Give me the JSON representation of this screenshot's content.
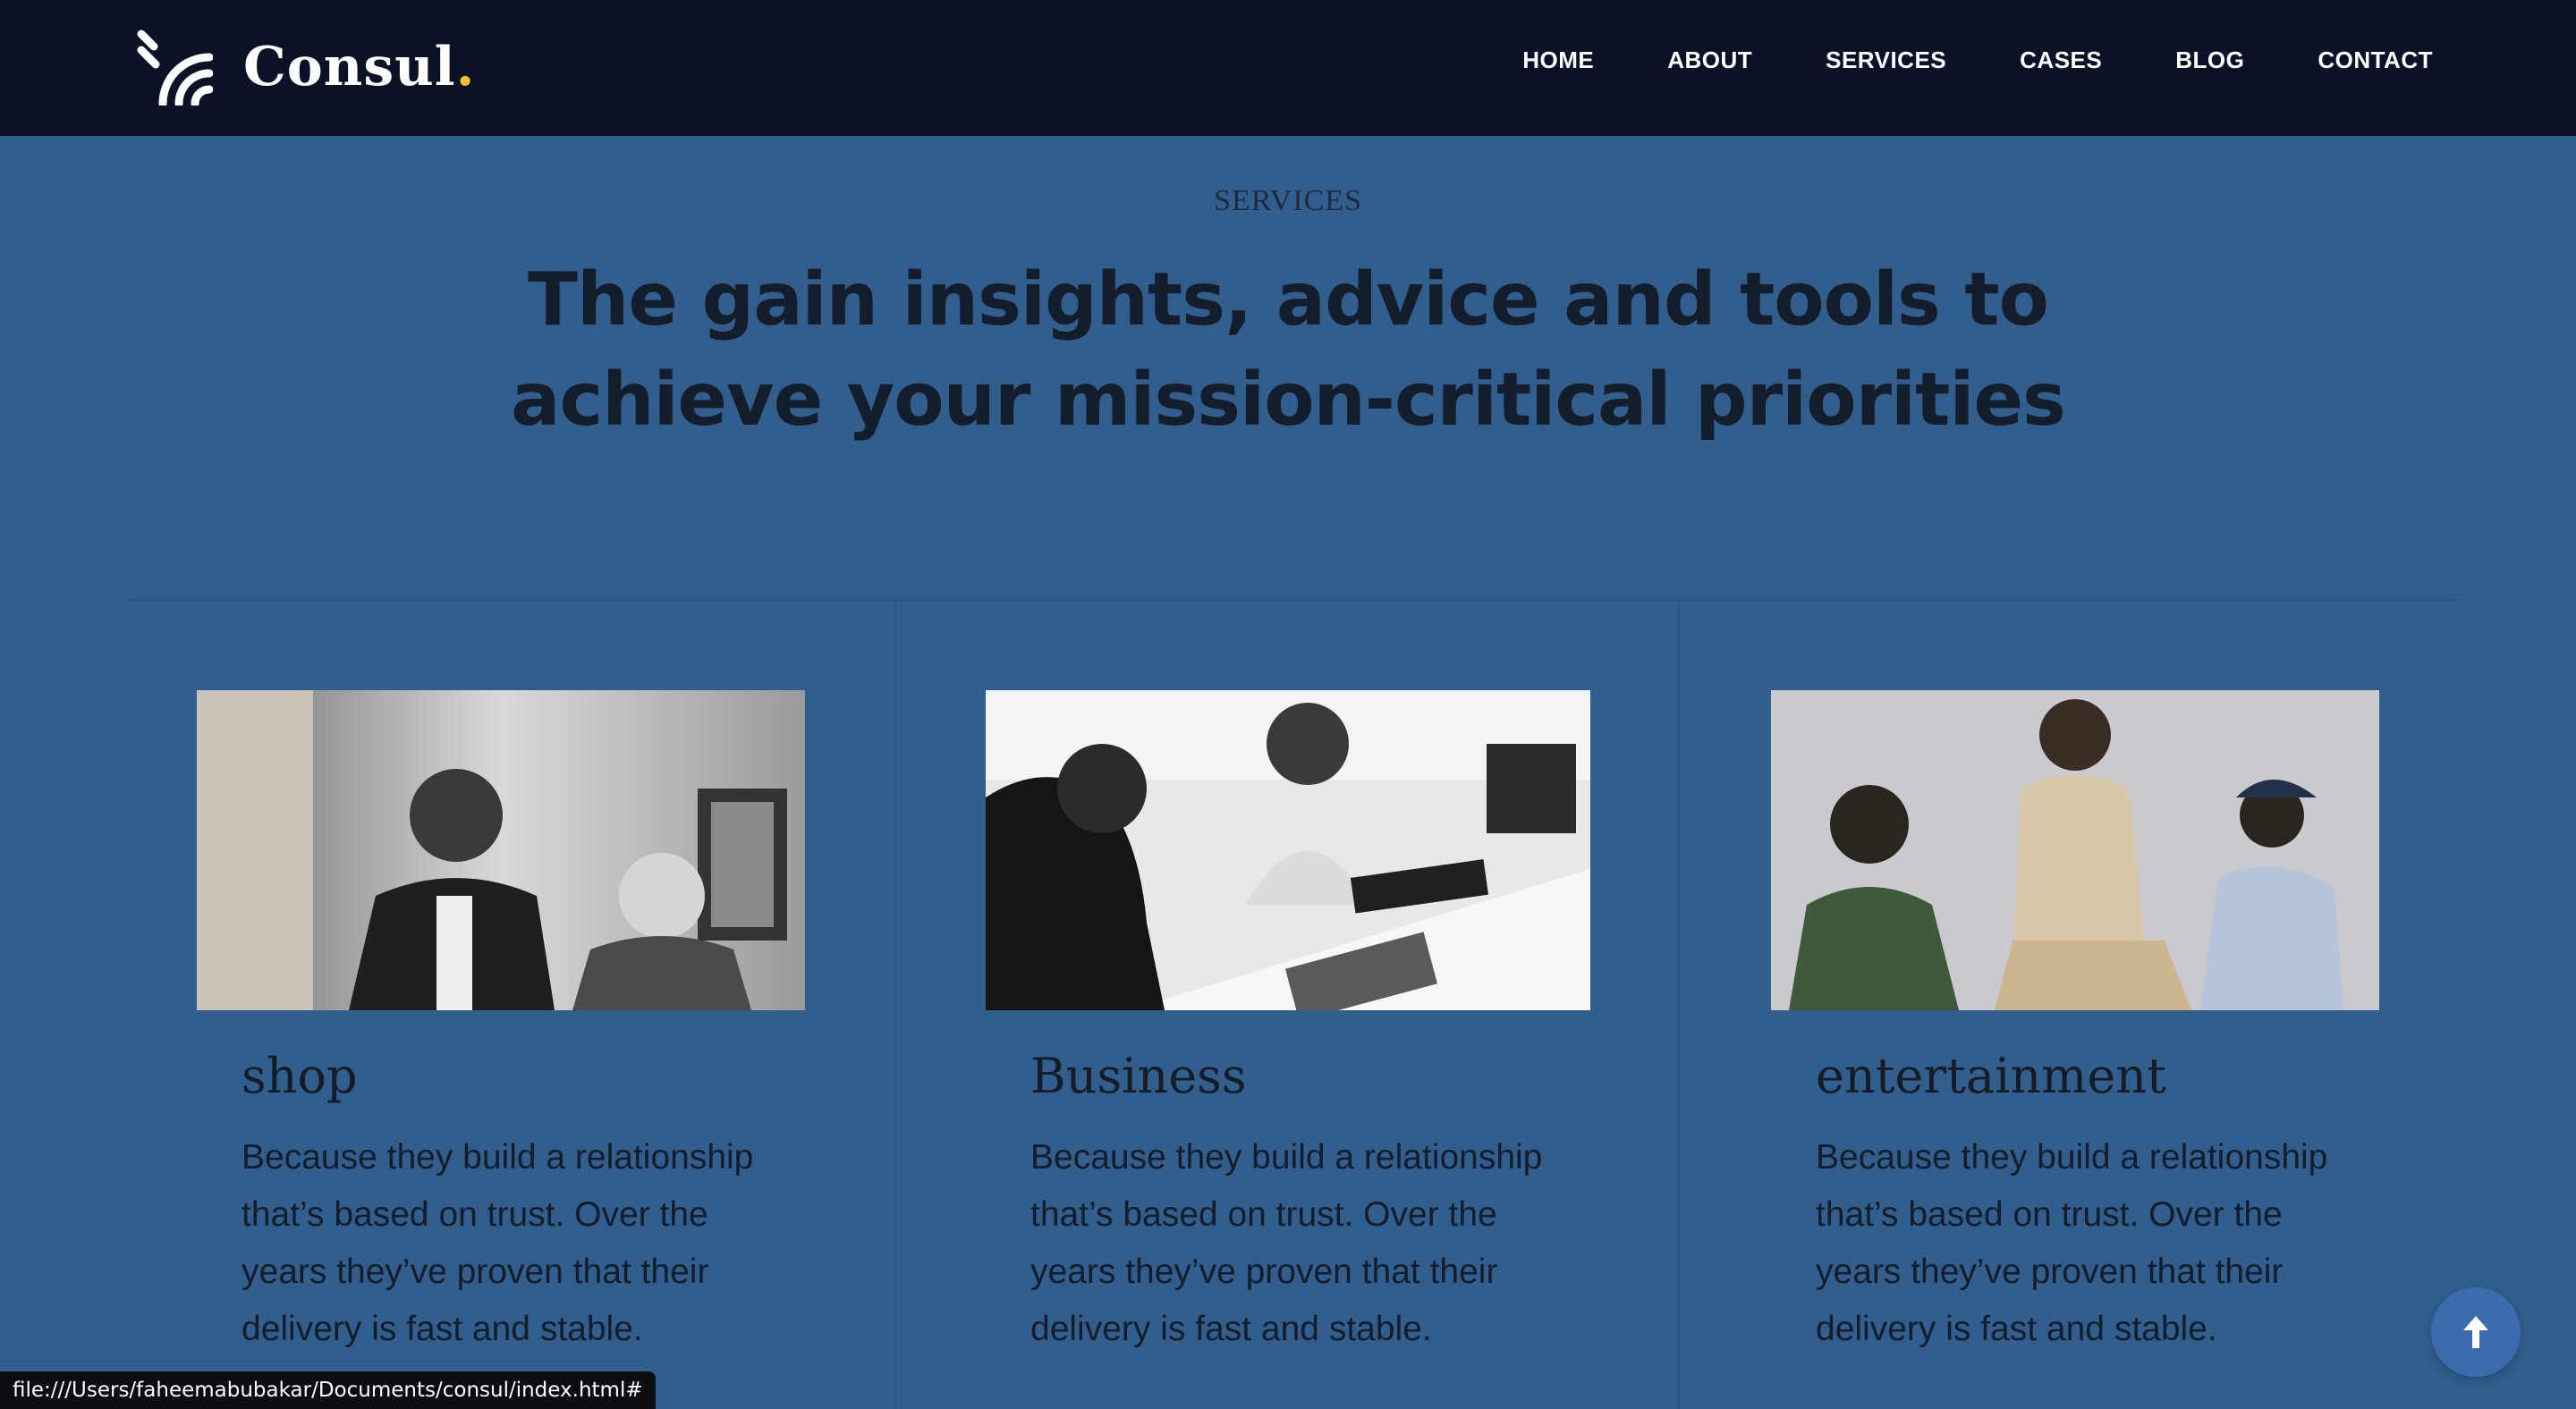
{
  "header": {
    "logo_text": "Consul",
    "logo_dot": ".",
    "nav": [
      {
        "label": "HOME"
      },
      {
        "label": "ABOUT"
      },
      {
        "label": "SERVICES"
      },
      {
        "label": "CASES"
      },
      {
        "label": "BLOG"
      },
      {
        "label": "CONTACT"
      }
    ]
  },
  "section": {
    "eyebrow": "SERVICES",
    "headline": "The gain insights, advice and tools to achieve your mission-critical priorities"
  },
  "cards": [
    {
      "title": "shop",
      "text": "Because they build a relationship that’s based on trust. Over the years they’ve proven that their delivery is fast and stable.",
      "image_icon": "photo-team-meeting"
    },
    {
      "title": "Business",
      "text": "Because they build a relationship that’s based on trust. Over the years they’ve proven that their delivery is fast and stable.",
      "image_icon": "photo-office-discussion"
    },
    {
      "title": "entertainment",
      "text": "Because they build a relationship that’s based on trust. Over the years they’ve proven that their delivery is fast and stable.",
      "image_icon": "photo-three-men"
    }
  ],
  "status_bar": {
    "url": "file:///Users/faheemabubakar/Documents/consul/index.html#"
  },
  "back_to_top": {
    "icon": "arrow-up-icon"
  },
  "colors": {
    "page_bg": "#315e8c",
    "header_bg": "#0b1126",
    "accent_dot": "#f2c230",
    "back_to_top_bg": "#3c6cae"
  }
}
